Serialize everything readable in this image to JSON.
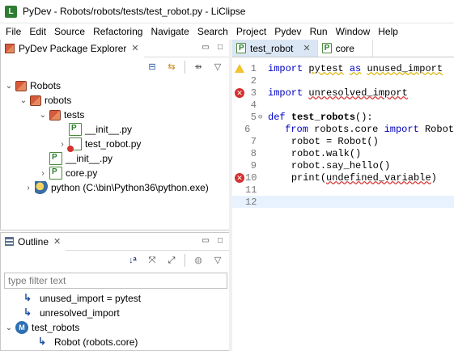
{
  "window": {
    "title": "PyDev - Robots/robots/tests/test_robot.py - LiClipse",
    "app_icon": "L"
  },
  "menu": [
    "File",
    "Edit",
    "Source",
    "Refactoring",
    "Navigate",
    "Search",
    "Project",
    "Pydev",
    "Run",
    "Window",
    "Help"
  ],
  "explorer": {
    "tab_label": "PyDev Package Explorer",
    "tree": [
      {
        "label": "Robots",
        "icon": "project-package-icon",
        "twisty": "v"
      },
      {
        "label": "robots",
        "icon": "package-icon",
        "twisty": "v"
      },
      {
        "label": "tests",
        "icon": "package-icon",
        "twisty": "v"
      },
      {
        "label": "__init__.py",
        "icon": "python-file-icon",
        "twisty": ""
      },
      {
        "label": "test_robot.py",
        "icon": "python-file-error-icon",
        "twisty": ">"
      },
      {
        "label": "__init__.py",
        "icon": "python-file-icon",
        "twisty": ""
      },
      {
        "label": "core.py",
        "icon": "python-file-icon",
        "twisty": ">"
      },
      {
        "label": "python  (C:\\bin\\Python36\\python.exe)",
        "icon": "python-interpreter-icon",
        "twisty": ">"
      }
    ]
  },
  "outline": {
    "tab_label": "Outline",
    "filter_placeholder": "type filter text",
    "items": [
      {
        "label": "unused_import = pytest",
        "icon": "import-icon",
        "twisty": ""
      },
      {
        "label": "unresolved_import",
        "icon": "import-icon",
        "twisty": ""
      },
      {
        "label": "test_robots",
        "icon": "method-icon",
        "twisty": "v"
      },
      {
        "label": "Robot (robots.core)",
        "icon": "import-icon",
        "twisty": ""
      }
    ]
  },
  "editor": {
    "tabs": [
      {
        "label": "test_robot",
        "active": true,
        "close": "✕"
      },
      {
        "label": "core",
        "active": false,
        "close": ""
      }
    ],
    "lines": [
      {
        "num": "1",
        "marker": "warning"
      },
      {
        "num": "2",
        "marker": ""
      },
      {
        "num": "3",
        "marker": "error"
      },
      {
        "num": "4",
        "marker": ""
      },
      {
        "num": "5",
        "marker": "",
        "fold": "⊖"
      },
      {
        "num": "6",
        "marker": ""
      },
      {
        "num": "7",
        "marker": ""
      },
      {
        "num": "8",
        "marker": ""
      },
      {
        "num": "9",
        "marker": ""
      },
      {
        "num": "10",
        "marker": "error"
      },
      {
        "num": "11",
        "marker": ""
      },
      {
        "num": "12",
        "marker": ""
      }
    ],
    "code": {
      "l1_kw1": "import",
      "l1_mod": "pytest",
      "l1_kw2": "as",
      "l1_alias": "unused_import",
      "l3_kw": "import",
      "l3_mod": "unresolved_import",
      "l5_kw": "def",
      "l5_name": "test_robots",
      "l5_rest": "():",
      "l6_kw1": "from",
      "l6_mod": "robots.core",
      "l6_kw2": "import",
      "l6_name": "Robot",
      "l7": "robot = Robot()",
      "l8": "robot.walk()",
      "l9": "robot.say_hello()",
      "l10_pre": "print(",
      "l10_var": "undefined_variable",
      "l10_post": ")"
    }
  },
  "colors": {
    "keyword": "#0000c0",
    "error": "#d62f2f",
    "warning": "#f2c230",
    "active_tab": "#dbe6f4"
  }
}
